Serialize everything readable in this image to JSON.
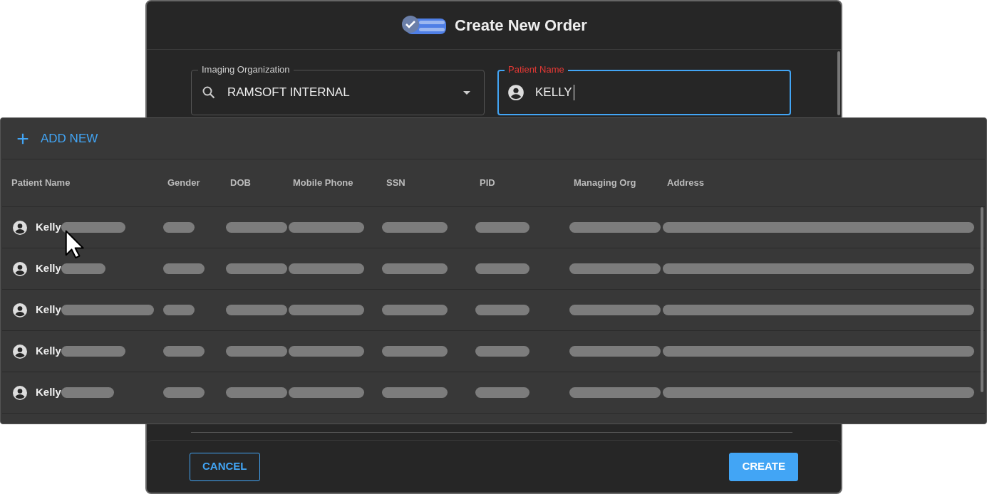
{
  "dialog": {
    "title": "Create New Order"
  },
  "fields": [
    {
      "kind": "select",
      "label": "Imaging Organization",
      "value": "RAMSOFT INTERNAL",
      "focused": false
    },
    {
      "kind": "person",
      "label": "Patient Name",
      "value": "KELLY",
      "focused": true
    }
  ],
  "dropdown": {
    "add_new": "ADD NEW",
    "columns": [
      "Patient Name",
      "Gender",
      "DOB",
      "Mobile Phone",
      "SSN",
      "PID",
      "Managing Org",
      "Address"
    ],
    "rows": [
      {
        "name": "Kelly"
      },
      {
        "name": "Kelly"
      },
      {
        "name": "Kelly"
      },
      {
        "name": "Kelly"
      },
      {
        "name": "Kelly"
      }
    ]
  },
  "buttons": [
    {
      "kind": "outline",
      "label": "CANCEL"
    },
    {
      "kind": "primary",
      "label": "CREATE"
    }
  ]
}
